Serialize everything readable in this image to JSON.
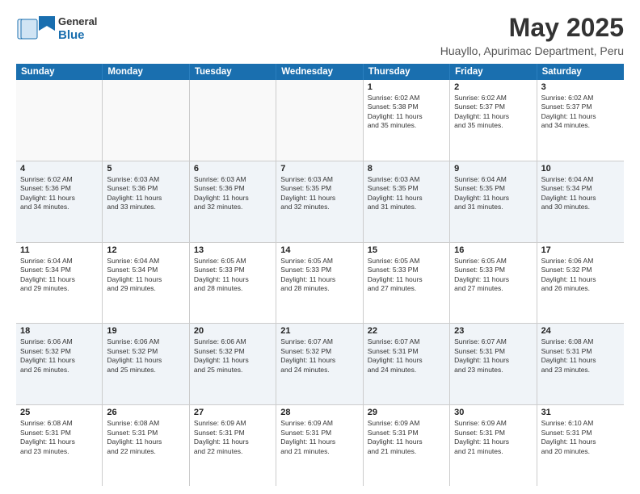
{
  "logo": {
    "general": "General",
    "blue": "Blue"
  },
  "title": "May 2025",
  "subtitle": "Huayllo, Apurimac Department, Peru",
  "header_days": [
    "Sunday",
    "Monday",
    "Tuesday",
    "Wednesday",
    "Thursday",
    "Friday",
    "Saturday"
  ],
  "weeks": [
    [
      {
        "day": "",
        "info": ""
      },
      {
        "day": "",
        "info": ""
      },
      {
        "day": "",
        "info": ""
      },
      {
        "day": "",
        "info": ""
      },
      {
        "day": "1",
        "info": "Sunrise: 6:02 AM\nSunset: 5:38 PM\nDaylight: 11 hours\nand 35 minutes."
      },
      {
        "day": "2",
        "info": "Sunrise: 6:02 AM\nSunset: 5:37 PM\nDaylight: 11 hours\nand 35 minutes."
      },
      {
        "day": "3",
        "info": "Sunrise: 6:02 AM\nSunset: 5:37 PM\nDaylight: 11 hours\nand 34 minutes."
      }
    ],
    [
      {
        "day": "4",
        "info": "Sunrise: 6:02 AM\nSunset: 5:36 PM\nDaylight: 11 hours\nand 34 minutes."
      },
      {
        "day": "5",
        "info": "Sunrise: 6:03 AM\nSunset: 5:36 PM\nDaylight: 11 hours\nand 33 minutes."
      },
      {
        "day": "6",
        "info": "Sunrise: 6:03 AM\nSunset: 5:36 PM\nDaylight: 11 hours\nand 32 minutes."
      },
      {
        "day": "7",
        "info": "Sunrise: 6:03 AM\nSunset: 5:35 PM\nDaylight: 11 hours\nand 32 minutes."
      },
      {
        "day": "8",
        "info": "Sunrise: 6:03 AM\nSunset: 5:35 PM\nDaylight: 11 hours\nand 31 minutes."
      },
      {
        "day": "9",
        "info": "Sunrise: 6:04 AM\nSunset: 5:35 PM\nDaylight: 11 hours\nand 31 minutes."
      },
      {
        "day": "10",
        "info": "Sunrise: 6:04 AM\nSunset: 5:34 PM\nDaylight: 11 hours\nand 30 minutes."
      }
    ],
    [
      {
        "day": "11",
        "info": "Sunrise: 6:04 AM\nSunset: 5:34 PM\nDaylight: 11 hours\nand 29 minutes."
      },
      {
        "day": "12",
        "info": "Sunrise: 6:04 AM\nSunset: 5:34 PM\nDaylight: 11 hours\nand 29 minutes."
      },
      {
        "day": "13",
        "info": "Sunrise: 6:05 AM\nSunset: 5:33 PM\nDaylight: 11 hours\nand 28 minutes."
      },
      {
        "day": "14",
        "info": "Sunrise: 6:05 AM\nSunset: 5:33 PM\nDaylight: 11 hours\nand 28 minutes."
      },
      {
        "day": "15",
        "info": "Sunrise: 6:05 AM\nSunset: 5:33 PM\nDaylight: 11 hours\nand 27 minutes."
      },
      {
        "day": "16",
        "info": "Sunrise: 6:05 AM\nSunset: 5:33 PM\nDaylight: 11 hours\nand 27 minutes."
      },
      {
        "day": "17",
        "info": "Sunrise: 6:06 AM\nSunset: 5:32 PM\nDaylight: 11 hours\nand 26 minutes."
      }
    ],
    [
      {
        "day": "18",
        "info": "Sunrise: 6:06 AM\nSunset: 5:32 PM\nDaylight: 11 hours\nand 26 minutes."
      },
      {
        "day": "19",
        "info": "Sunrise: 6:06 AM\nSunset: 5:32 PM\nDaylight: 11 hours\nand 25 minutes."
      },
      {
        "day": "20",
        "info": "Sunrise: 6:06 AM\nSunset: 5:32 PM\nDaylight: 11 hours\nand 25 minutes."
      },
      {
        "day": "21",
        "info": "Sunrise: 6:07 AM\nSunset: 5:32 PM\nDaylight: 11 hours\nand 24 minutes."
      },
      {
        "day": "22",
        "info": "Sunrise: 6:07 AM\nSunset: 5:31 PM\nDaylight: 11 hours\nand 24 minutes."
      },
      {
        "day": "23",
        "info": "Sunrise: 6:07 AM\nSunset: 5:31 PM\nDaylight: 11 hours\nand 23 minutes."
      },
      {
        "day": "24",
        "info": "Sunrise: 6:08 AM\nSunset: 5:31 PM\nDaylight: 11 hours\nand 23 minutes."
      }
    ],
    [
      {
        "day": "25",
        "info": "Sunrise: 6:08 AM\nSunset: 5:31 PM\nDaylight: 11 hours\nand 23 minutes."
      },
      {
        "day": "26",
        "info": "Sunrise: 6:08 AM\nSunset: 5:31 PM\nDaylight: 11 hours\nand 22 minutes."
      },
      {
        "day": "27",
        "info": "Sunrise: 6:09 AM\nSunset: 5:31 PM\nDaylight: 11 hours\nand 22 minutes."
      },
      {
        "day": "28",
        "info": "Sunrise: 6:09 AM\nSunset: 5:31 PM\nDaylight: 11 hours\nand 21 minutes."
      },
      {
        "day": "29",
        "info": "Sunrise: 6:09 AM\nSunset: 5:31 PM\nDaylight: 11 hours\nand 21 minutes."
      },
      {
        "day": "30",
        "info": "Sunrise: 6:09 AM\nSunset: 5:31 PM\nDaylight: 11 hours\nand 21 minutes."
      },
      {
        "day": "31",
        "info": "Sunrise: 6:10 AM\nSunset: 5:31 PM\nDaylight: 11 hours\nand 20 minutes."
      }
    ]
  ]
}
